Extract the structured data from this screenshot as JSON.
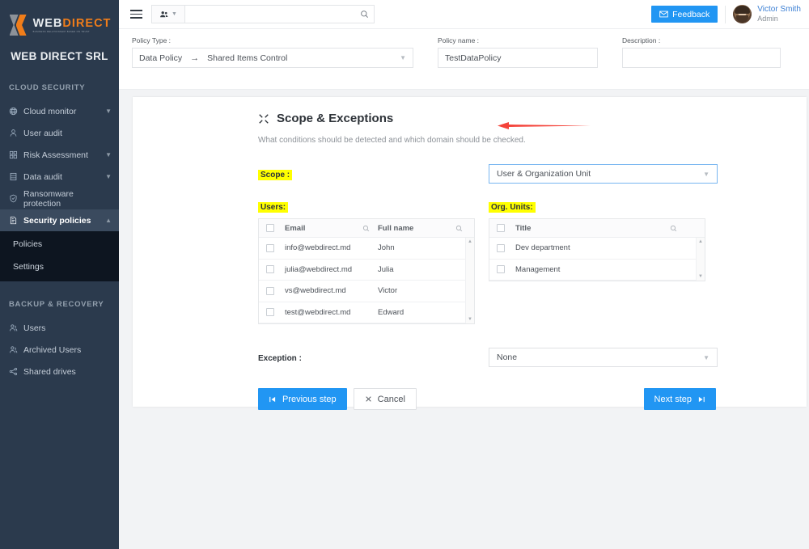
{
  "brand": {
    "logo_web": "WEB",
    "logo_direct": "DIRECT",
    "logo_tagline": "BUSINESS RELATIONSHIP BASED ON TRUST",
    "company": "WEB DIRECT SRL"
  },
  "sidebar": {
    "sections": [
      {
        "title": "CLOUD SECURITY",
        "items": [
          {
            "label": "Cloud monitor",
            "icon": "globe-icon",
            "chevron": "down"
          },
          {
            "label": "User audit",
            "icon": "user-icon",
            "chevron": ""
          },
          {
            "label": "Risk Assessment",
            "icon": "grid-icon",
            "chevron": "down"
          },
          {
            "label": "Data audit",
            "icon": "database-icon",
            "chevron": "down"
          },
          {
            "label": "Ransomware protection",
            "icon": "shield-check-icon",
            "chevron": ""
          },
          {
            "label": "Security policies",
            "icon": "policy-document-icon",
            "chevron": "up",
            "active": true
          }
        ],
        "submenu": [
          {
            "label": "Policies"
          },
          {
            "label": "Settings"
          }
        ]
      },
      {
        "title": "BACKUP & RECOVERY",
        "items": [
          {
            "label": "Users",
            "icon": "users-icon",
            "chevron": ""
          },
          {
            "label": "Archived Users",
            "icon": "users-icon",
            "chevron": ""
          },
          {
            "label": "Shared drives",
            "icon": "share-icon",
            "chevron": ""
          }
        ]
      }
    ]
  },
  "topbar": {
    "menu_icon": "hamburger-icon",
    "scope_selector_icon": "people-icon",
    "search_placeholder": "",
    "search_value": "",
    "search_icon": "search-icon",
    "feedback_label": "Feedback",
    "feedback_icon": "envelope-icon",
    "user_name": "Victor Smith",
    "user_role": "Admin"
  },
  "policy_bar": {
    "policy_type_label": "Policy Type :",
    "policy_type_value_1": "Data Policy",
    "policy_type_arrow": "→",
    "policy_type_value_2": "Shared Items Control",
    "policy_name_label": "Policy name :",
    "policy_name_value": "TestDataPolicy",
    "description_label": "Description :",
    "description_value": ""
  },
  "panel": {
    "section_icon": "scope-crosshair-icon",
    "section_title": "Scope & Exceptions",
    "section_subtitle": "What conditions should be detected and which domain should be checked.",
    "scope_label": "Scope :",
    "scope_value": "User & Organization Unit",
    "users_label": "Users:",
    "org_units_label": "Org. Units:",
    "users_table": {
      "columns": [
        "Email",
        "Full name"
      ],
      "rows": [
        {
          "email": "info@webdirect.md",
          "full_name": "John"
        },
        {
          "email": "julia@webdirect.md",
          "full_name": "Julia"
        },
        {
          "email": "vs@webdirect.md",
          "full_name": "Victor"
        },
        {
          "email": "test@webdirect.md",
          "full_name": "Edward"
        }
      ]
    },
    "org_units_table": {
      "columns": [
        "Title"
      ],
      "rows": [
        {
          "title": "Dev department"
        },
        {
          "title": "Management"
        }
      ]
    },
    "exception_label": "Exception :",
    "exception_value": "None",
    "previous_step_label": "Previous step",
    "previous_step_icon": "skip-back-icon",
    "cancel_label": "Cancel",
    "cancel_icon": "close-x-icon",
    "next_step_label": "Next step",
    "next_step_icon": "skip-forward-icon"
  },
  "annotation": {
    "arrow_icon": "red-left-arrow",
    "arrow_color": "#f4433a"
  },
  "colors": {
    "sidebar_bg": "#2b3a4d",
    "sidebar_active": "#3a4a5e",
    "submenu_bg": "#0d1520",
    "accent_blue": "#2196f3",
    "brand_orange": "#f07d1a",
    "highlight_yellow": "#ffff00"
  }
}
